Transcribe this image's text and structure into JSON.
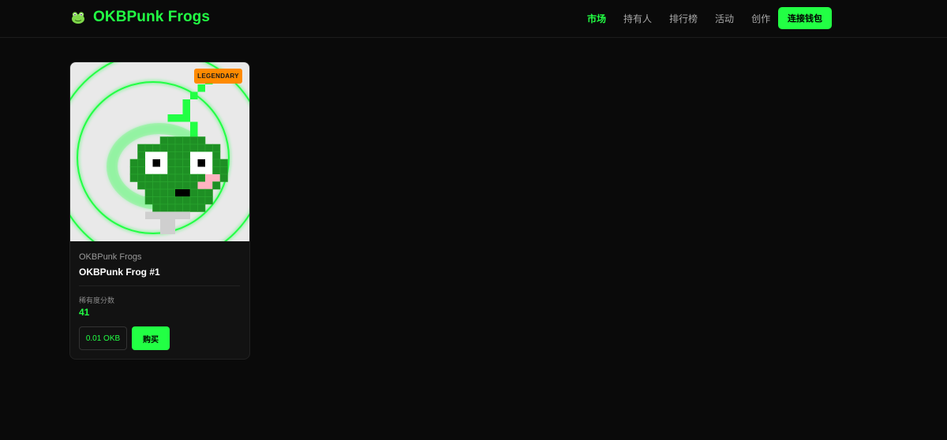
{
  "header": {
    "brand_icon": "frog-icon",
    "brand_name": "OKBPunk Frogs",
    "nav": [
      {
        "label": "市场",
        "active": true
      },
      {
        "label": "持有人",
        "active": false
      },
      {
        "label": "排行榜",
        "active": false
      },
      {
        "label": "活动",
        "active": false
      },
      {
        "label": "创作",
        "active": false
      }
    ],
    "connect_label": "连接钱包"
  },
  "colors": {
    "accent": "#22ff44",
    "background": "#0a0a0a",
    "card": "#121212",
    "legendary": "#ff8a00",
    "frog_green": "#1e8f24",
    "image_bg": "#e9e9e9"
  },
  "card": {
    "image": "pixel-frog-nft",
    "rarity_badge": "LEGENDARY",
    "collection": "OKBPunk Frogs",
    "name": "OKBPunk Frog #1",
    "rarity_label": "稀有度分数",
    "rarity_score": "41",
    "price": "0.01 OKB",
    "buy_label": "购买"
  }
}
